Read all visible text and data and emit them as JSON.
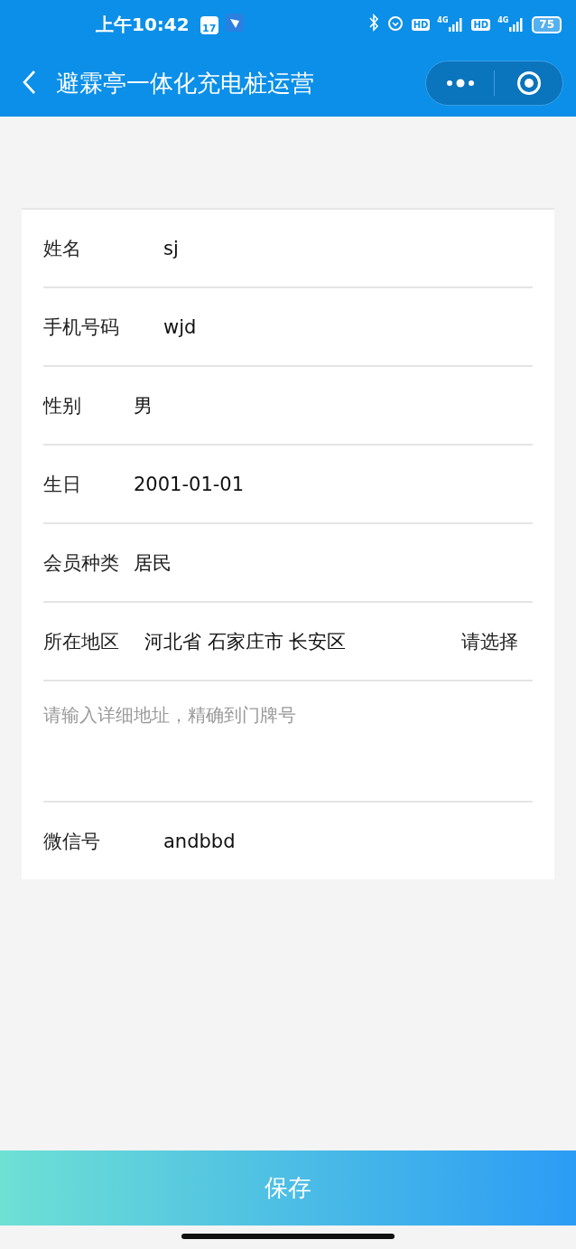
{
  "status_bar": {
    "time": "上午10:42",
    "calendar_day": "17",
    "network": [
      {
        "badge": "HD",
        "generation": "4G"
      },
      {
        "badge": "HD",
        "generation": "4G"
      }
    ],
    "battery": "75"
  },
  "nav_bar": {
    "title": "避霖亭一体化充电桩运营"
  },
  "form": {
    "rows": [
      {
        "kind": "input",
        "label": "姓名",
        "value": "sj"
      },
      {
        "kind": "input",
        "label": "手机号码",
        "value": "wjd"
      },
      {
        "kind": "picker",
        "label": "性别",
        "value": "男"
      },
      {
        "kind": "picker",
        "label": "生日",
        "value": "2001-01-01"
      },
      {
        "kind": "picker",
        "label": "会员种类",
        "value": "居民"
      },
      {
        "kind": "region",
        "label": "所在地区",
        "value": "河北省 石家庄市 长安区",
        "action": "请选择"
      },
      {
        "kind": "textarea",
        "placeholder": "请输入详细地址，精确到门牌号"
      },
      {
        "kind": "input",
        "label": "微信号",
        "value": "andbbd"
      }
    ]
  },
  "save_button": {
    "label": "保存"
  }
}
